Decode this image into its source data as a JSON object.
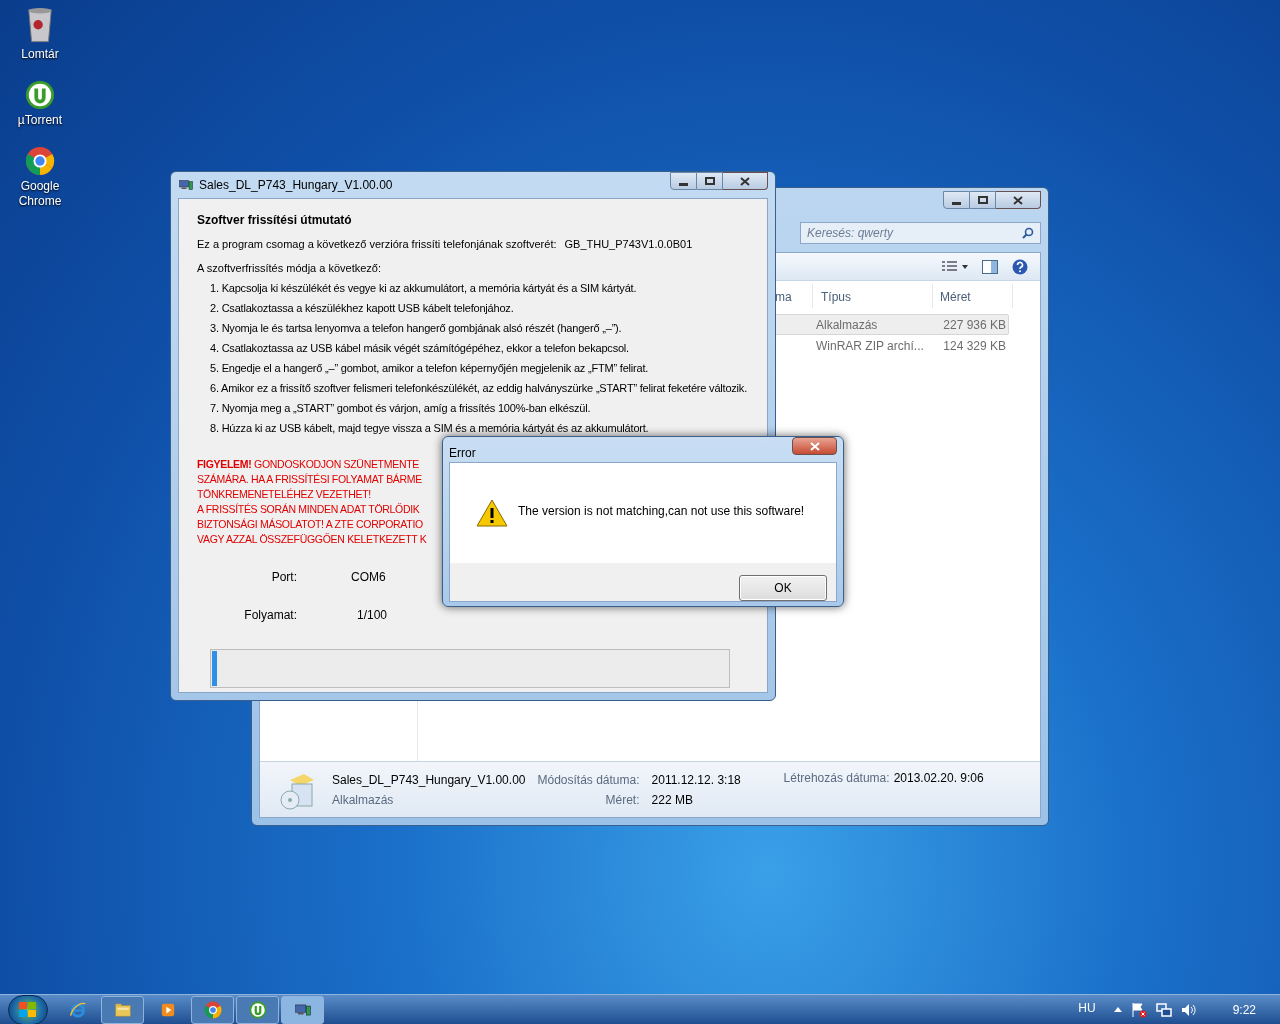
{
  "desktop_icons": [
    {
      "label": "Lomtár",
      "kind": "trash"
    },
    {
      "label": "µTorrent",
      "kind": "utorrent"
    },
    {
      "label": "Google Chrome",
      "kind": "chrome"
    }
  ],
  "explorer": {
    "search": {
      "placeholder": "Keresés: qwerty"
    },
    "columns": [
      "ma",
      "Típus",
      "Méret"
    ],
    "rows": [
      {
        "type": "Alkalmazás",
        "size": "227 936 KB",
        "selected": true
      },
      {
        "type": "WinRAR ZIP archí...",
        "size": "124 329 KB",
        "selected": false
      }
    ],
    "details": {
      "name": "Sales_DL_P743_Hungary_V1.00.00",
      "type": "Alkalmazás",
      "modified": {
        "label": "Módosítás dátuma:",
        "value": "2011.12.12. 3:18"
      },
      "size": {
        "label": "Méret:",
        "value": "222 MB"
      },
      "created": {
        "label": "Létrehozás dátuma:",
        "value": "2013.02.20. 9:06"
      }
    }
  },
  "updater": {
    "title": "Sales_DL_P743_Hungary_V1.00.00",
    "heading": "Szoftver frissítési útmutató",
    "intro": "Ez a program csomag a következő verzióra frissíti telefonjának szoftverét:",
    "version": "GB_THU_P743V1.0.0B01",
    "method": "A szoftverfrissítés módja a következő:",
    "steps": [
      "1. Kapcsolja ki készülékét és vegye ki az akkumulátort, a memória kártyát és a SIM kártyát.",
      "2. Csatlakoztassa a készülékhez kapott USB kábelt telefonjához.",
      "3. Nyomja le és tartsa lenyomva a telefon hangerő gombjának alsó részét (hangerő „–”).",
      "4. Csatlakoztassa az USB kábel másik végét számítógépéhez, ekkor a telefon bekapcsol.",
      "5. Engedje el a hangerő „–” gombot, amikor a telefon képernyőjén megjelenik az „FTM” felirat.",
      "6. Amikor ez a frissítő szoftver felismeri telefonkészülékét, az eddig halványszürke „START” felirat feketére változik.",
      "7. Nyomja meg a „START” gombot és várjon, amíg a frissítés 100%-ban elkészül.",
      "8. Húzza ki az USB kábelt, majd tegye vissza a SIM és a memória kártyát és az akkumulátort."
    ],
    "warning": [
      "**FIGYELEM!** GONDOSKODJON SZÜNETMENTE",
      "SZÁMÁRA. HA A FRISSÍTÉSI FOLYAMAT BÁRME",
      "TÖNKREMENETELÉHEZ VEZETHET!",
      "A FRISSÍTÉS SORÁN MINDEN ADAT TÖRLŐDIK",
      "BIZTONSÁGI MÁSOLATOT! A ZTE CORPORATIO",
      "VAGY AZZAL ÖSSZEFÜGGŐEN KELETKEZETT K"
    ],
    "port": {
      "label": "Port:",
      "value": "COM6"
    },
    "progress": {
      "label": "Folyamat:",
      "value": "1/100",
      "level": 0.01
    }
  },
  "error_dialog": {
    "title": "Error",
    "message": "The version is not matching,can not use this software!",
    "button": "OK"
  },
  "taskbar": {
    "apps": [
      {
        "kind": "ie",
        "running": false,
        "selected": false
      },
      {
        "kind": "folder",
        "running": true,
        "selected": false
      },
      {
        "kind": "media",
        "running": false,
        "selected": false
      },
      {
        "kind": "chrome",
        "running": true,
        "selected": false
      },
      {
        "kind": "utorrent",
        "running": true,
        "selected": false
      },
      {
        "kind": "updater",
        "running": true,
        "selected": true
      }
    ],
    "language": "HU",
    "time": "9:22"
  }
}
